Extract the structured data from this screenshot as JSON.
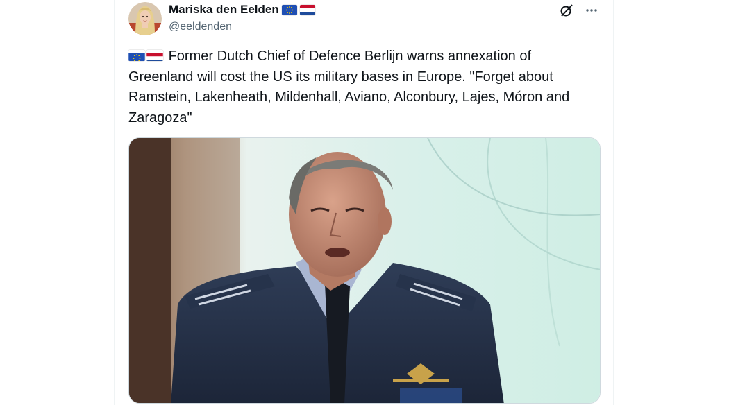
{
  "author": {
    "name": "Mariska den Eelden",
    "handle": "@eeldenden",
    "flags": [
      "eu-flag-icon",
      "netherlands-flag-icon"
    ]
  },
  "actions": {
    "grok": "grok-icon",
    "more": "more-icon"
  },
  "tweet": {
    "line1": "Former Dutch Chief of Defence Berlijn warns annexation of",
    "line2": "Greenland will cost the US its military bases in Europe. \"Forget about",
    "line3": "Ramstein, Lakenheath, Mildenhall, Aviano, Alconbury, Lajes, Móron and",
    "line4": "Zaragoza\""
  },
  "colors": {
    "text": "#0f1419",
    "secondary": "#536471",
    "border": "#cfd9de"
  }
}
